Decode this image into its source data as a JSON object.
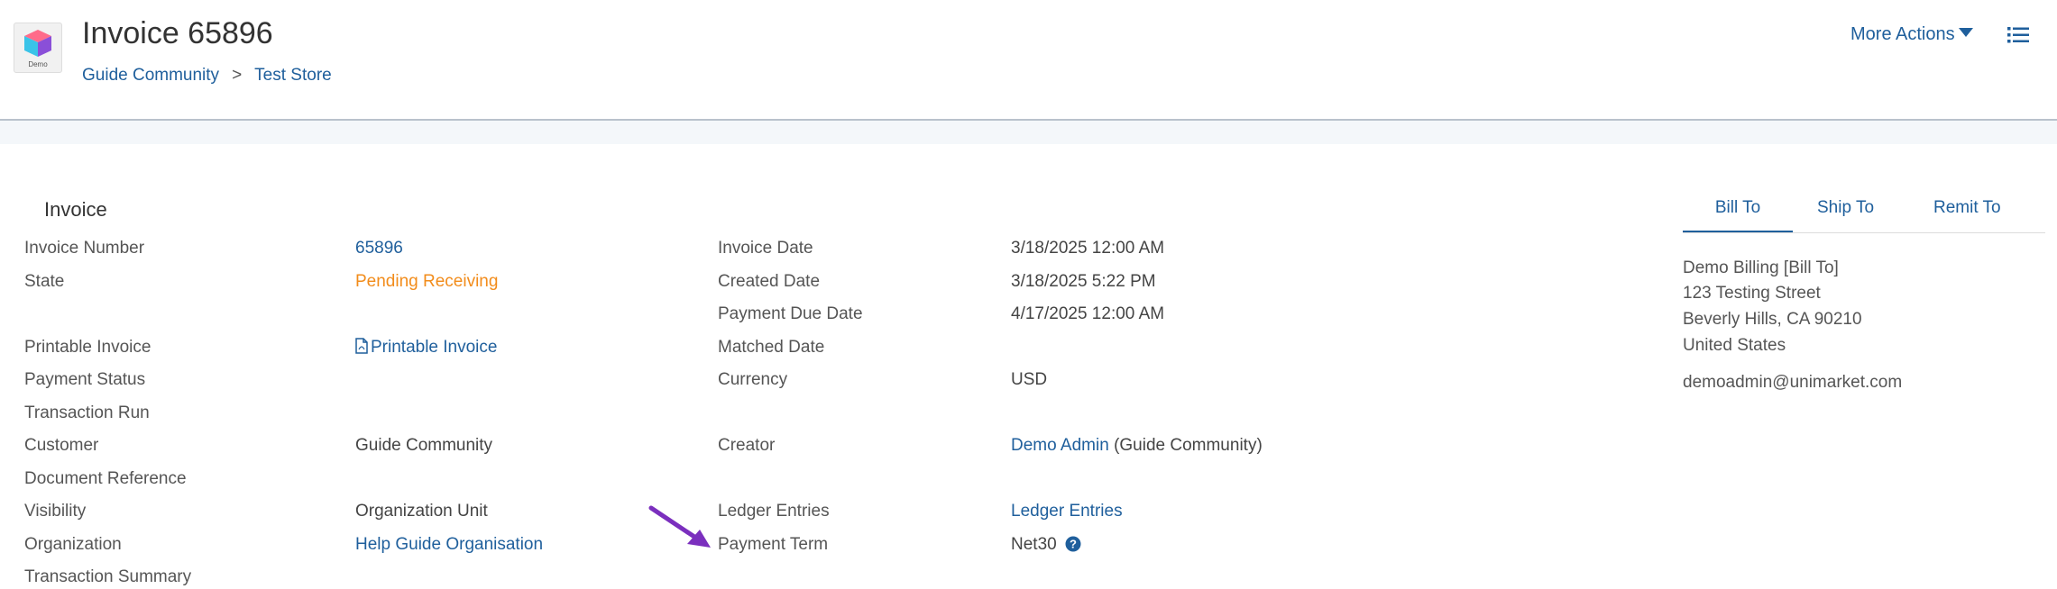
{
  "header": {
    "title": "Invoice 65896",
    "logo_text": "Demo",
    "breadcrumb": [
      "Guide Community",
      "Test Store"
    ],
    "breadcrumb_sep": ">",
    "more_actions": "More Actions"
  },
  "section": {
    "title": "Invoice"
  },
  "left_col": [
    {
      "label": "Invoice Number",
      "value": "65896"
    },
    {
      "label": "State",
      "value": "Pending Receiving"
    },
    {
      "label": "Printable Invoice",
      "value": "Printable Invoice"
    },
    {
      "label": "Payment Status",
      "value": ""
    },
    {
      "label": "Transaction Run",
      "value": ""
    },
    {
      "label": "Customer",
      "value": "Guide Community"
    },
    {
      "label": "Document Reference",
      "value": ""
    },
    {
      "label": "Visibility",
      "value": "Organization Unit"
    },
    {
      "label": "Organization",
      "value": "Help Guide Organisation"
    },
    {
      "label": "Transaction Summary",
      "value": ""
    }
  ],
  "right_col": [
    {
      "label": "Invoice Date",
      "value": "3/18/2025 12:00 AM"
    },
    {
      "label": "Created Date",
      "value": "3/18/2025 5:22 PM"
    },
    {
      "label": "Payment Due Date",
      "value": "4/17/2025 12:00 AM"
    },
    {
      "label": "Matched Date",
      "value": ""
    },
    {
      "label": "Currency",
      "value": "USD"
    },
    {
      "label": "Creator",
      "value": "Demo Admin",
      "suffix": "(Guide Community)"
    },
    {
      "label": "Ledger Entries",
      "value": "Ledger Entries"
    },
    {
      "label": "Payment Term",
      "value": "Net30"
    }
  ],
  "address_tabs": [
    "Bill To",
    "Ship To",
    "Remit To"
  ],
  "address": {
    "line1": "Demo Billing [Bill To]",
    "line2": "123 Testing Street",
    "line3": "Beverly Hills, CA 90210",
    "line4": "United States",
    "email": "demoadmin@unimarket.com"
  },
  "colors": {
    "link": "#1f5f9c",
    "state": "#f28c1b",
    "arrow": "#7b2fbe"
  }
}
